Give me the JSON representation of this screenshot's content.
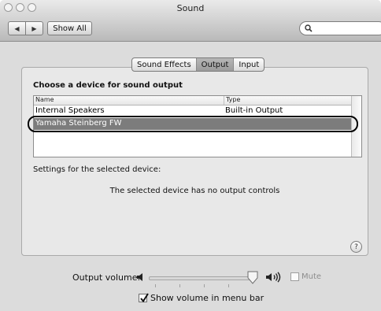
{
  "window": {
    "title": "Sound"
  },
  "toolbar": {
    "back_glyph": "◀",
    "forward_glyph": "▶",
    "show_all_label": "Show All",
    "search_value": ""
  },
  "tabs": [
    {
      "label": "Sound Effects",
      "selected": false
    },
    {
      "label": "Output",
      "selected": true
    },
    {
      "label": "Input",
      "selected": false
    }
  ],
  "output": {
    "heading": "Choose a device for sound output",
    "columns": [
      "Name",
      "Type"
    ],
    "devices": [
      {
        "name": "Internal Speakers",
        "type": "Built-in Output",
        "selected": false
      },
      {
        "name": "Yamaha Steinberg FW",
        "type": "",
        "selected": true
      }
    ],
    "settings_label": "Settings for the selected device:",
    "no_controls_message": "The selected device has no output controls",
    "help_glyph": "?"
  },
  "volume": {
    "label": "Output volume:",
    "level": 1.0,
    "mute_label": "Mute",
    "mute_checked": false,
    "mute_enabled": false,
    "show_in_menubar_label": "Show volume in menu bar",
    "show_in_menubar_checked": true
  },
  "colors": {
    "selection": "#7c7c7c",
    "window_bg": "#dcdcdc",
    "panel_bg": "#e8e8e8"
  }
}
